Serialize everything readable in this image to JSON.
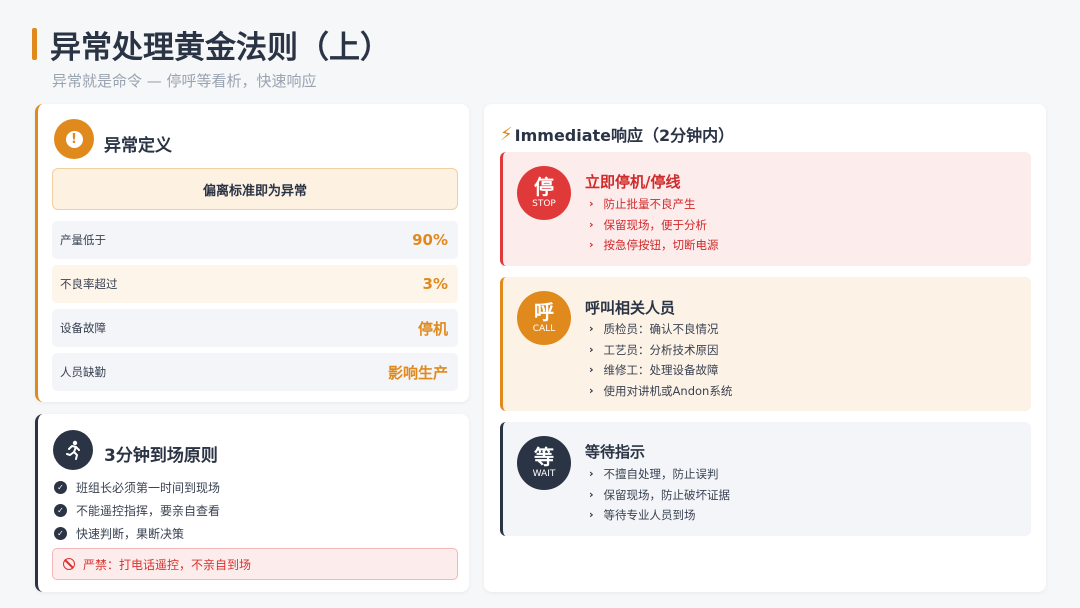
{
  "header": {
    "title": "异常处理黄金法则（上）",
    "subtitle": "异常就是命令 — 停呼等看析，快速响应"
  },
  "definition": {
    "title": "异常定义",
    "highlight": "偏离标准即为异常",
    "rows": [
      {
        "label": "产量低于",
        "value": "90%"
      },
      {
        "label": "不良率超过",
        "value": "3%"
      },
      {
        "label": "设备故障",
        "value": "停机"
      },
      {
        "label": "人员缺勤",
        "value": "影响生产"
      }
    ]
  },
  "three_min": {
    "title": "3分钟到场原则",
    "items": [
      "班组长必须第一时间到现场",
      "不能遥控指挥，要亲自查看",
      "快速判断，果断决策"
    ],
    "warning": "严禁：打电话遥控，不亲自到场"
  },
  "immediate": {
    "title": "Immediate响应（2分钟内）",
    "blocks": [
      {
        "char": "停",
        "code": "STOP",
        "title": "立即停机/停线",
        "items": [
          "防止批量不良产生",
          "保留现场，便于分析",
          "按急停按钮，切断电源"
        ]
      },
      {
        "char": "呼",
        "code": "CALL",
        "title": "呼叫相关人员",
        "items": [
          "质检员：确认不良情况",
          "工艺员：分析技术原因",
          "维修工：处理设备故障",
          "使用对讲机或Andon系统"
        ]
      },
      {
        "char": "等",
        "code": "WAIT",
        "title": "等待指示",
        "items": [
          "不擅自处理，防止误判",
          "保留现场，防止破坏证据",
          "等待专业人员到场"
        ]
      }
    ]
  },
  "colors": {
    "accent": "#e08a1e",
    "dark": "#2b3445",
    "danger": "#e0393a"
  }
}
